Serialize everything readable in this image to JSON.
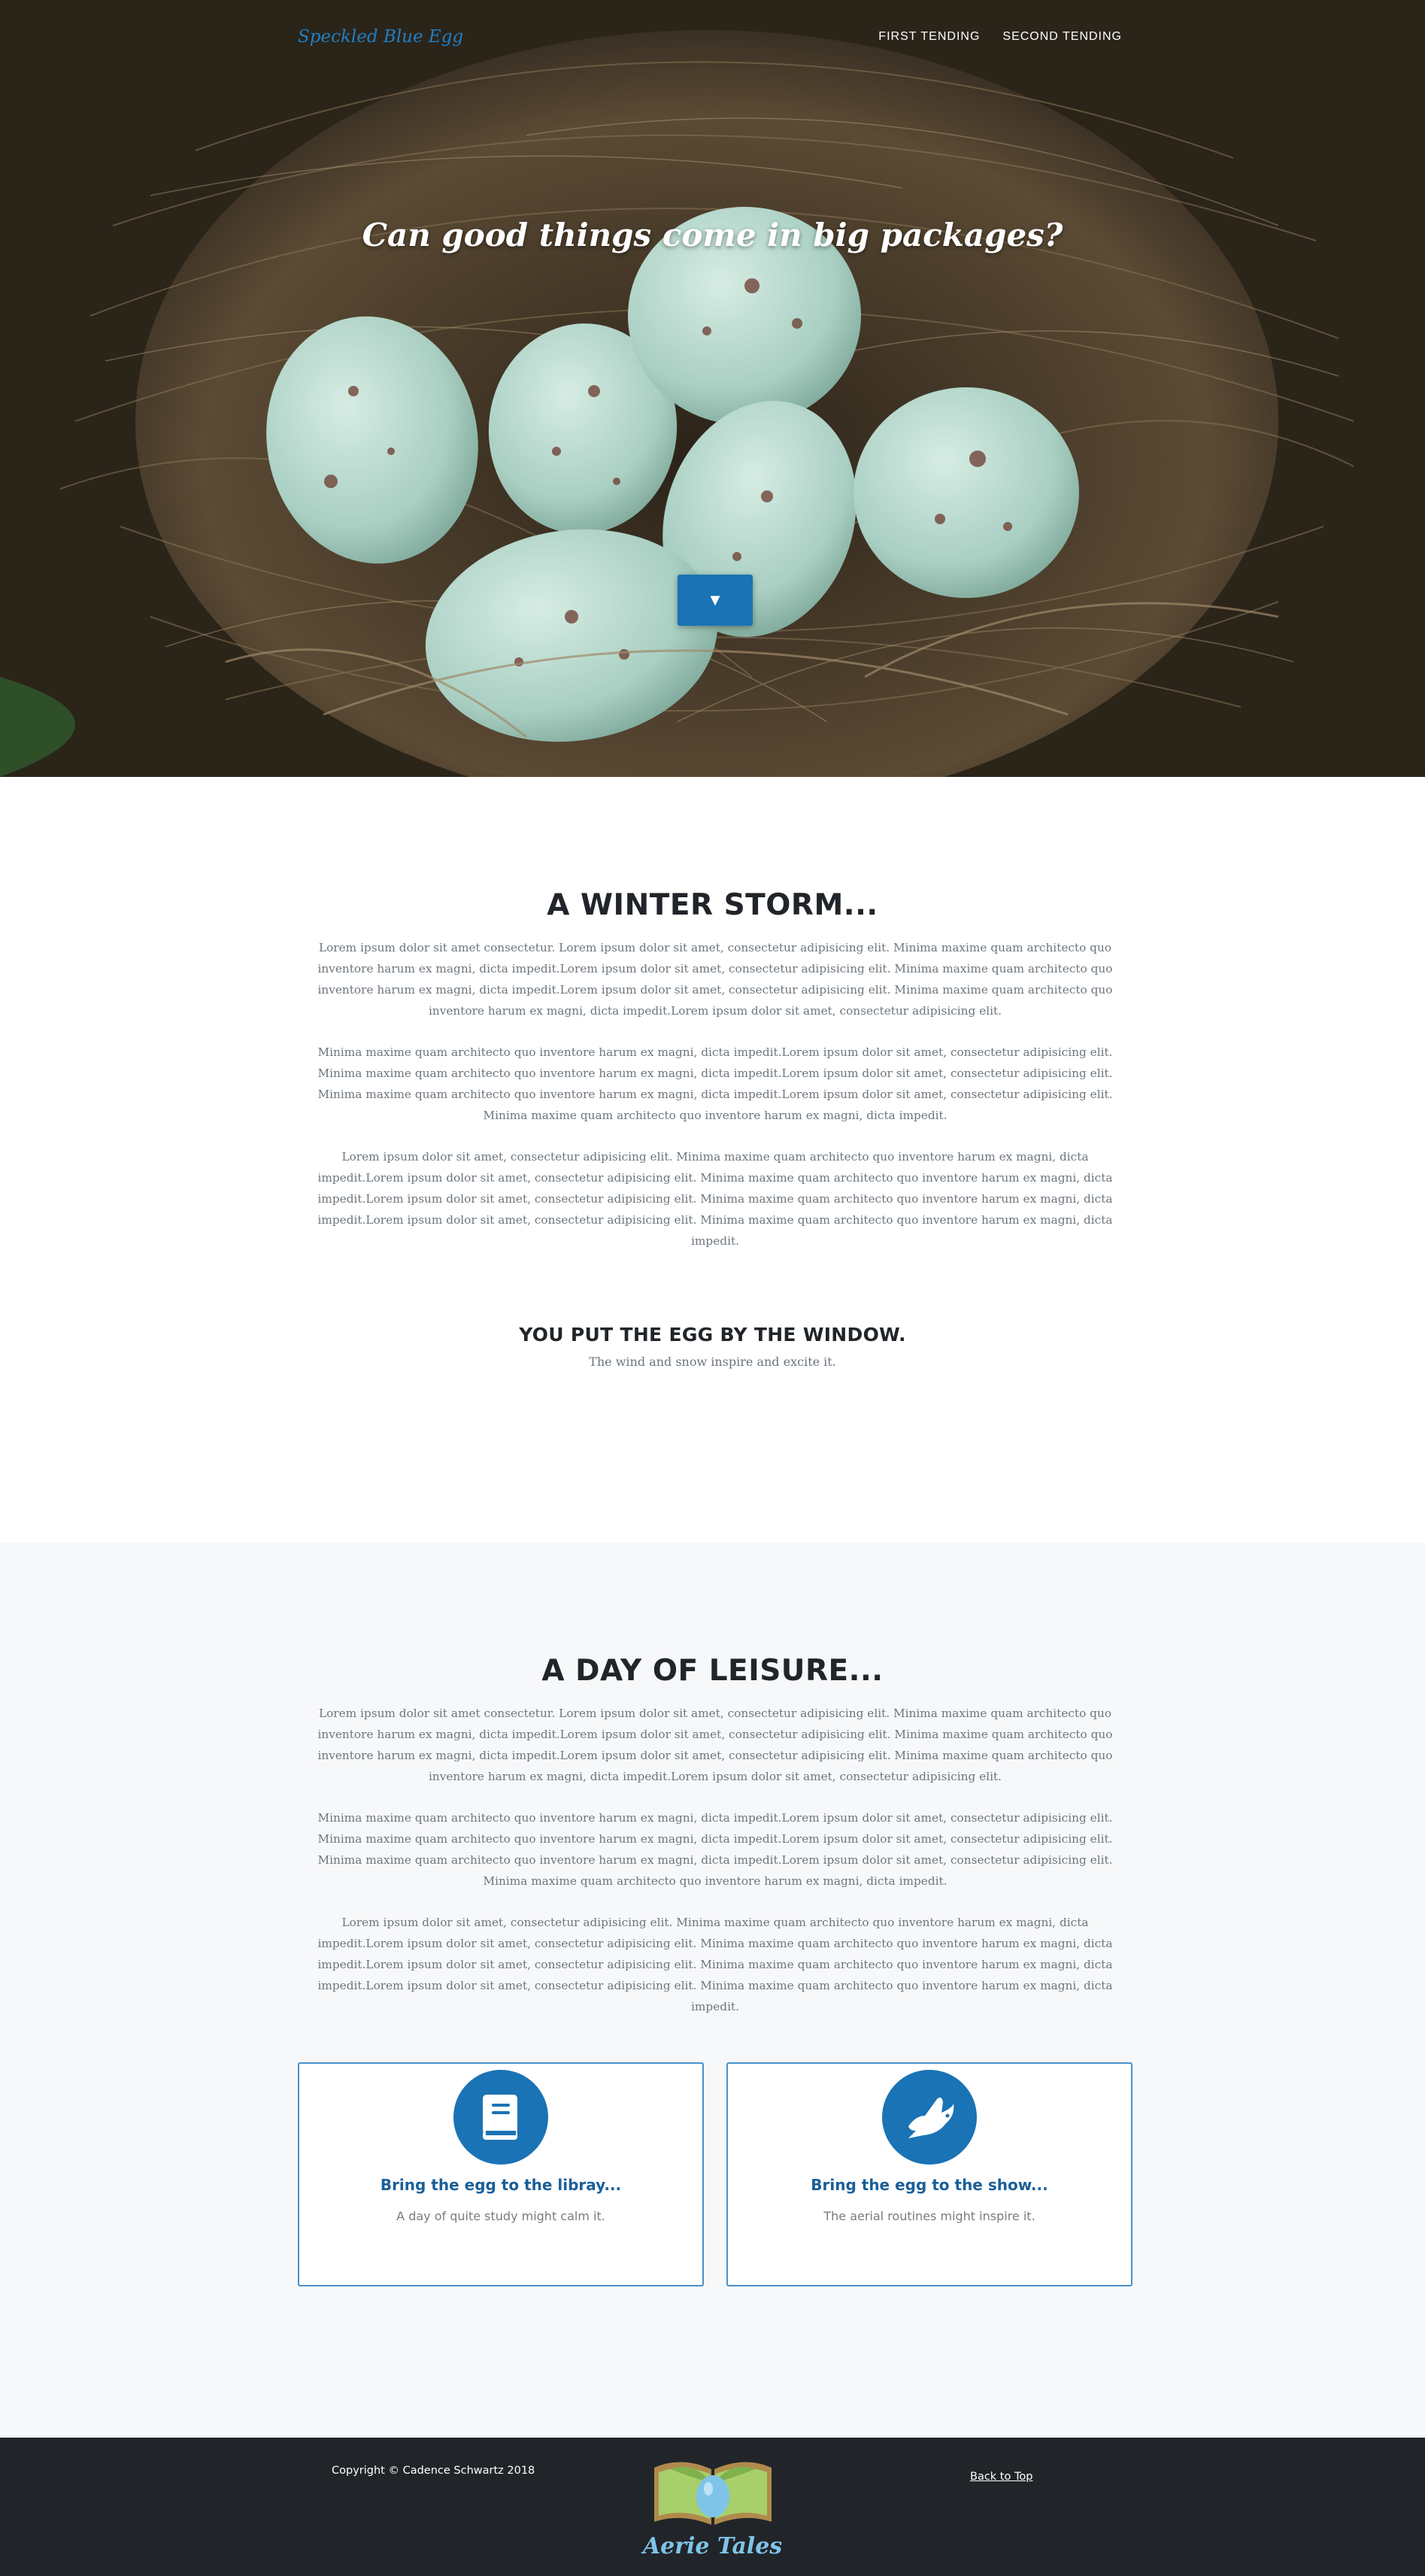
{
  "nav": {
    "brand": "Speckled Blue Egg",
    "links": [
      "FIRST TENDING",
      "SECOND TENDING"
    ]
  },
  "hero": {
    "title": "Can good things come in big packages?",
    "scroll_button": "▼"
  },
  "winter": {
    "heading": "A WINTER STORM...",
    "paragraphs": [
      "Lorem ipsum dolor sit amet consectetur. Lorem ipsum dolor sit amet, consectetur adipisicing elit. Minima maxime quam architecto quo inventore harum ex magni, dicta impedit.Lorem ipsum dolor sit amet, consectetur adipisicing elit. Minima maxime quam architecto quo inventore harum ex magni, dicta impedit.Lorem ipsum dolor sit amet, consectetur adipisicing elit. Minima maxime quam architecto quo inventore harum ex magni, dicta impedit.Lorem ipsum dolor sit amet, consectetur adipisicing elit.",
      "Minima maxime quam architecto quo inventore harum ex magni, dicta impedit.Lorem ipsum dolor sit amet, consectetur adipisicing elit. Minima maxime quam architecto quo inventore harum ex magni, dicta impedit.Lorem ipsum dolor sit amet, consectetur adipisicing elit. Minima maxime quam architecto quo inventore harum ex magni, dicta impedit.Lorem ipsum dolor sit amet, consectetur adipisicing elit. Minima maxime quam architecto quo inventore harum ex magni, dicta impedit.",
      "Lorem ipsum dolor sit amet, consectetur adipisicing elit. Minima maxime quam architecto quo inventore harum ex magni, dicta impedit.Lorem ipsum dolor sit amet, consectetur adipisicing elit. Minima maxime quam architecto quo inventore harum ex magni, dicta impedit.Lorem ipsum dolor sit amet, consectetur adipisicing elit. Minima maxime quam architecto quo inventore harum ex magni, dicta impedit.Lorem ipsum dolor sit amet, consectetur adipisicing elit. Minima maxime quam architecto quo inventore harum ex magni, dicta impedit."
    ],
    "subheading": "YOU PUT THE EGG BY THE WINDOW.",
    "subtext": "The wind and snow inspire and excite it."
  },
  "leisure": {
    "heading": "A DAY OF LEISURE...",
    "paragraphs": [
      "Lorem ipsum dolor sit amet consectetur. Lorem ipsum dolor sit amet, consectetur adipisicing elit. Minima maxime quam architecto quo inventore harum ex magni, dicta impedit.Lorem ipsum dolor sit amet, consectetur adipisicing elit. Minima maxime quam architecto quo inventore harum ex magni, dicta impedit.Lorem ipsum dolor sit amet, consectetur adipisicing elit. Minima maxime quam architecto quo inventore harum ex magni, dicta impedit.Lorem ipsum dolor sit amet, consectetur adipisicing elit.",
      "Minima maxime quam architecto quo inventore harum ex magni, dicta impedit.Lorem ipsum dolor sit amet, consectetur adipisicing elit. Minima maxime quam architecto quo inventore harum ex magni, dicta impedit.Lorem ipsum dolor sit amet, consectetur adipisicing elit. Minima maxime quam architecto quo inventore harum ex magni, dicta impedit.Lorem ipsum dolor sit amet, consectetur adipisicing elit. Minima maxime quam architecto quo inventore harum ex magni, dicta impedit.",
      "Lorem ipsum dolor sit amet, consectetur adipisicing elit. Minima maxime quam architecto quo inventore harum ex magni, dicta impedit.Lorem ipsum dolor sit amet, consectetur adipisicing elit. Minima maxime quam architecto quo inventore harum ex magni, dicta impedit.Lorem ipsum dolor sit amet, consectetur adipisicing elit. Minima maxime quam architecto quo inventore harum ex magni, dicta impedit.Lorem ipsum dolor sit amet, consectetur adipisicing elit. Minima maxime quam architecto quo inventore harum ex magni, dicta impedit."
    ],
    "cards": [
      {
        "icon": "book-icon",
        "title": "Bring the egg to the libray...",
        "text": "A day of quite study might calm it."
      },
      {
        "icon": "dove-icon",
        "title": "Bring the egg to the show...",
        "text": "The aerial routines might inspire it."
      }
    ]
  },
  "footer": {
    "copyright": "Copyright © Cadence Schwartz 2018",
    "back_to_top": "Back to Top",
    "logo_text": "Aerie Tales"
  },
  "colors": {
    "accent": "#1a73b5",
    "card_title": "#1a5f98",
    "footer_bg": "#212529",
    "section_alt_bg": "#f7f8fa",
    "logo_text": "#7fc4e8"
  }
}
